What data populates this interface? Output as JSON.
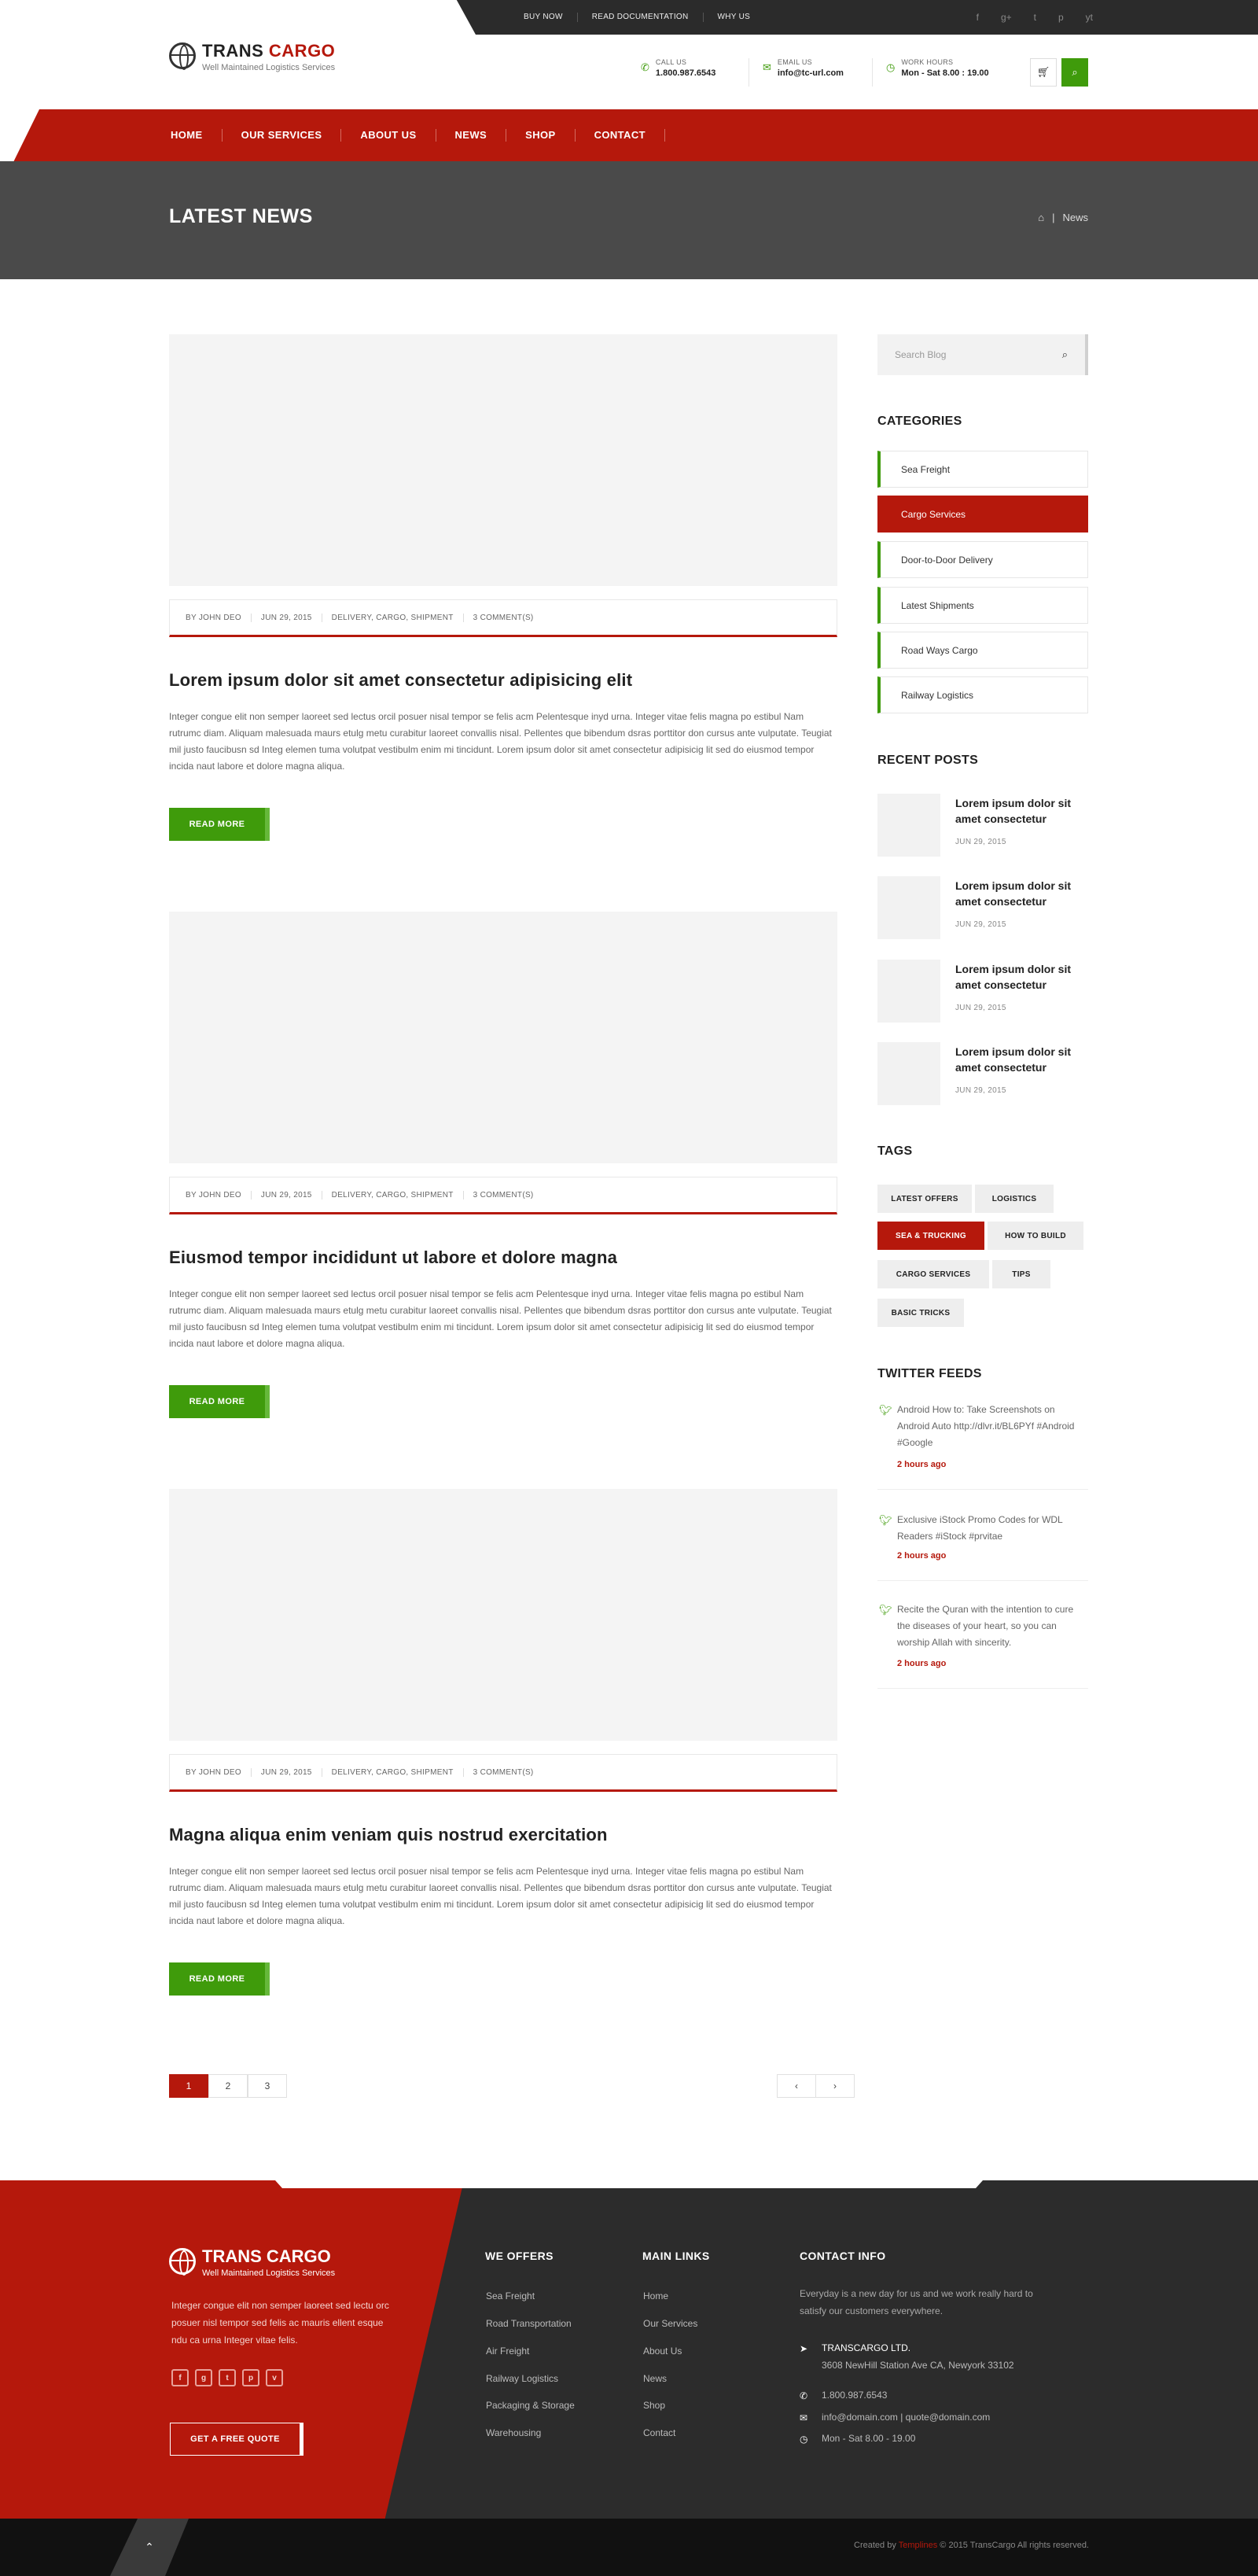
{
  "topbar": {
    "links": [
      "BUY NOW",
      "READ DOCUMENTATION",
      "WHY US"
    ],
    "social": [
      "f",
      "g+",
      "t",
      "p",
      "yt"
    ]
  },
  "header": {
    "logo_trans": "TRANS",
    "logo_cargo": "CARGO",
    "tagline": "Well Maintained Logistics Services",
    "call_label": "CALL US",
    "call_value": "1.800.987.6543",
    "email_label": "EMAIL US",
    "email_value": "info@tc-url.com",
    "hours_label": "WORK HOURS",
    "hours_value": "Mon - Sat 8.00 : 19.00"
  },
  "nav": [
    "HOME",
    "OUR SERVICES",
    "ABOUT US",
    "NEWS",
    "SHOP",
    "CONTACT"
  ],
  "titlebar": {
    "title": "LATEST NEWS",
    "crumb": "News"
  },
  "posts": [
    {
      "author": "BY JOHN DEO",
      "date": "JUN 29, 2015",
      "tags": "DELIVERY, CARGO, SHIPMENT",
      "comments": "3 COMMENT(S)",
      "title": "Lorem ipsum dolor sit amet consectetur adipisicing elit",
      "text": "Integer congue elit non semper laoreet sed lectus orcil posuer nisal tempor se felis acm Pelentesque inyd urna. Integer vitae felis magna po estibul Nam rutrumc diam. Aliquam malesuada maurs etulg metu curabitur laoreet convallis nisal. Pellentes que bibendum dsras porttitor don cursus ante vulputate. Teugiat mil justo faucibusn sd Integ elemen tuma volutpat vestibulm enim mi tincidunt. Lorem ipsum dolor sit amet consectetur adipisicig lit sed do eiusmod tempor incida naut labore et dolore magna aliqua.",
      "button": "READ MORE"
    },
    {
      "author": "BY JOHN DEO",
      "date": "JUN 29, 2015",
      "tags": "DELIVERY, CARGO, SHIPMENT",
      "comments": "3 COMMENT(S)",
      "title": "Eiusmod tempor incididunt ut labore et dolore magna",
      "text": "Integer congue elit non semper laoreet sed lectus orcil posuer nisal tempor se felis acm Pelentesque inyd urna. Integer vitae felis magna po estibul Nam rutrumc diam. Aliquam malesuada maurs etulg metu curabitur laoreet convallis nisal. Pellentes que bibendum dsras porttitor don cursus ante vulputate. Teugiat mil justo faucibusn sd Integ elemen tuma volutpat vestibulm enim mi tincidunt. Lorem ipsum dolor sit amet consectetur adipisicig lit sed do eiusmod tempor incida naut labore et dolore magna aliqua.",
      "button": "READ MORE"
    },
    {
      "author": "BY JOHN DEO",
      "date": "JUN 29, 2015",
      "tags": "DELIVERY, CARGO, SHIPMENT",
      "comments": "3 COMMENT(S)",
      "title": "Magna aliqua enim veniam quis nostrud exercitation",
      "text": "Integer congue elit non semper laoreet sed lectus orcil posuer nisal tempor se felis acm Pelentesque inyd urna. Integer vitae felis magna po estibul Nam rutrumc diam. Aliquam malesuada maurs etulg metu curabitur laoreet convallis nisal. Pellentes que bibendum dsras porttitor don cursus ante vulputate. Teugiat mil justo faucibusn sd Integ elemen tuma volutpat vestibulm enim mi tincidunt. Lorem ipsum dolor sit amet consectetur adipisicig lit sed do eiusmod tempor incida naut labore et dolore magna aliqua.",
      "button": "READ MORE"
    }
  ],
  "pagination": {
    "pages": [
      "1",
      "2",
      "3"
    ],
    "current": "1",
    "prev": "‹",
    "next": "›"
  },
  "sidebar": {
    "search_placeholder": "Search Blog",
    "categories_title": "CATEGORIES",
    "categories": [
      "Sea Freight",
      "Cargo Services",
      "Door-to-Door Delivery",
      "Latest Shipments",
      "Road Ways Cargo",
      "Railway Logistics"
    ],
    "active_category": "Cargo Services",
    "recent_title": "RECENT POSTS",
    "recent": [
      {
        "title": "Lorem ipsum dolor sit amet consectetur",
        "date": "JUN 29, 2015"
      },
      {
        "title": "Lorem ipsum dolor sit amet consectetur",
        "date": "JUN 29, 2015"
      },
      {
        "title": "Lorem ipsum dolor sit amet consectetur",
        "date": "JUN 29, 2015"
      },
      {
        "title": "Lorem ipsum dolor sit amet consectetur",
        "date": "JUN 29, 2015"
      }
    ],
    "tags_title": "TAGS",
    "tags": [
      "LATEST OFFERS",
      "LOGISTICS",
      "SEA & TRUCKING",
      "HOW TO BUILD",
      "CARGO SERVICES",
      "TIPS",
      "BASIC TRICKS"
    ],
    "active_tag": "SEA & TRUCKING",
    "twitter_title": "TWITTER FEEDS",
    "tweets": [
      {
        "text": "Android How to: Take Screenshots on Android Auto http://dlvr.it/BL6PYf #Android #Google",
        "time": "2 hours ago"
      },
      {
        "text": "Exclusive iStock Promo Codes for WDL Readers #iStock #prvitae",
        "time": "2 hours ago"
      },
      {
        "text": "Recite the Quran with the intention to cure the diseases of your heart, so you can worship Allah with sincerity.",
        "time": "2 hours ago"
      }
    ]
  },
  "footer": {
    "logo": "TRANS CARGO",
    "tagline": "Well Maintained Logistics Services",
    "about": "Integer congue elit non semper laoreet sed lectu orc posuer nisl tempor sed felis ac mauris ellent esque ndu ca urna Integer vitae felis.",
    "social": [
      "f",
      "g",
      "t",
      "p",
      "v"
    ],
    "quote_button": "GET A FREE QUOTE",
    "offers_title": "WE OFFERS",
    "offers": [
      "Sea Freight",
      "Road Transportation",
      "Air Freight",
      "Railway Logistics",
      "Packaging & Storage",
      "Warehousing"
    ],
    "links_title": "MAIN LINKS",
    "links": [
      "Home",
      "Our Services",
      "About Us",
      "News",
      "Shop",
      "Contact"
    ],
    "contact_title": "CONTACT INFO",
    "contact_text": "Everyday is a new day for us and we work really hard to satisfy our customers everywhere.",
    "company": "TRANSCARGO LTD.",
    "address": "3608 NewHill Station Ave CA, Newyork 33102",
    "phone": "1.800.987.6543",
    "email": "info@domain.com  |  quote@domain.com",
    "hours": "Mon - Sat  8.00 - 19.00"
  },
  "bottom": {
    "created_by": "Created by",
    "brand": "Templines",
    "rights": "© 2015 TransCargo All rights reserved."
  },
  "colors": {
    "brand_red": "#b5180c",
    "brand_green": "#3f9b0b",
    "dark": "#2b2b2b"
  }
}
